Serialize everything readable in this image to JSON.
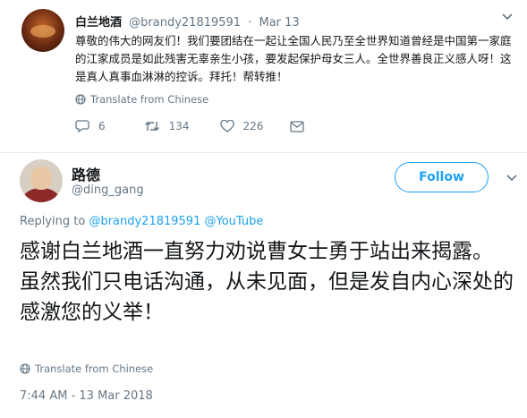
{
  "top_tweet": {
    "name": "白兰地酒",
    "handle": "@brandy21819591",
    "separator": "·",
    "date": "Mar 13",
    "text": "尊敬的伟大的网友们！我们要团结在一起让全国人民乃至全世界知道曾经是中国第一家庭的江家成员是如此残害无辜亲生小孩，要发起保护母女三人。全世界善良正义感人呀！这是真人真事血淋淋的控诉。拜托！帮转推！",
    "translate_label": "Translate from Chinese",
    "reply_count": "6",
    "retweet_count": "134",
    "like_count": "226"
  },
  "main_tweet": {
    "name": "路德",
    "handle": "@ding_gang",
    "follow_label": "Follow",
    "replying_prefix": "Replying to",
    "replying_mention_1": "@brandy21819591",
    "replying_mention_2": "@YouTube",
    "text_line_1": "感谢白兰地酒一直努力劝说曹女士勇于站出来揭露。",
    "text_line_2": "虽然我们只电话沟通，从未见面，但是发自内心深处的感激您的义举！",
    "translate_label": "Translate from Chinese",
    "timestamp": "7:44 AM - 13 Mar 2018"
  },
  "colors": {
    "accent": "#1da1f2",
    "secondary_text": "#657786",
    "divider": "#e6ecf0"
  }
}
